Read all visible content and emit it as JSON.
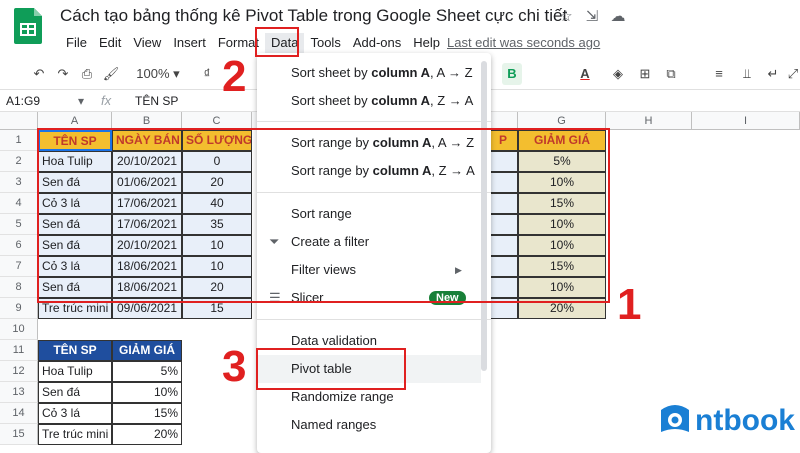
{
  "app": {
    "title": "Cách tạo bảng thống kê Pivot Table trong Google Sheet cực chi tiết",
    "last_edit": "Last edit was seconds ago"
  },
  "menubar": [
    "File",
    "Edit",
    "View",
    "Insert",
    "Format",
    "Data",
    "Tools",
    "Add-ons",
    "Help"
  ],
  "toolbar": {
    "zoom": "100%",
    "currency": "₫",
    "bold": "B",
    "text_color": "A"
  },
  "formula": {
    "name_box": "A1:G9",
    "fx": "fx",
    "content": "TÊN SP"
  },
  "columns": [
    "A",
    "B",
    "C",
    "G",
    "H",
    "I"
  ],
  "col_partial_f": "P",
  "rows": [
    "1",
    "2",
    "3",
    "4",
    "5",
    "6",
    "7",
    "8",
    "9",
    "10",
    "11",
    "12",
    "13",
    "14",
    "15"
  ],
  "table1": {
    "headers": [
      "TÊN SP",
      "NGÀY BÁN",
      "SỐ LƯỢNG"
    ],
    "g_header": "GIẢM GIÁ",
    "rows": [
      [
        "Hoa Tulip",
        "20/10/2021",
        "0",
        "5%"
      ],
      [
        "Sen đá",
        "01/06/2021",
        "20",
        "10%"
      ],
      [
        "Cỏ 3 lá",
        "17/06/2021",
        "40",
        "15%"
      ],
      [
        "Sen đá",
        "17/06/2021",
        "35",
        "10%"
      ],
      [
        "Sen đá",
        "20/10/2021",
        "10",
        "10%"
      ],
      [
        "Cỏ 3 lá",
        "18/06/2021",
        "10",
        "15%"
      ],
      [
        "Sen đá",
        "18/06/2021",
        "20",
        "10%"
      ],
      [
        "Tre trúc mini",
        "09/06/2021",
        "15",
        "20%"
      ]
    ]
  },
  "table2": {
    "headers": [
      "TÊN SP",
      "GIẢM GIÁ"
    ],
    "rows": [
      [
        "Hoa Tulip",
        "5%"
      ],
      [
        "Sen đá",
        "10%"
      ],
      [
        "Cỏ 3 lá",
        "15%"
      ],
      [
        "Tre trúc mini",
        "20%"
      ]
    ]
  },
  "menu": {
    "items": [
      {
        "pre": "Sort sheet by ",
        "bold": "column A",
        "post": ", A → Z"
      },
      {
        "pre": "Sort sheet by ",
        "bold": "column A",
        "post": ", Z → A"
      },
      {
        "pre": "Sort range by ",
        "bold": "column A",
        "post": ", A → Z"
      },
      {
        "pre": "Sort range by ",
        "bold": "column A",
        "post": ", Z → A"
      }
    ],
    "sort_range": "Sort range",
    "create_filter": "Create a filter",
    "filter_views": "Filter views",
    "slicer": "Slicer",
    "new_badge": "New",
    "data_validation": "Data validation",
    "pivot_table": "Pivot table",
    "randomize": "Randomize range",
    "named_ranges": "Named ranges"
  },
  "annotations": {
    "n1": "1",
    "n2": "2",
    "n3": "3"
  },
  "watermark": "ntbook",
  "colors": {
    "accent_red": "#e02020",
    "header_yellow": "#f3be2f",
    "header_blue": "#1f4e9e",
    "sheets_green": "#0f9d58"
  }
}
